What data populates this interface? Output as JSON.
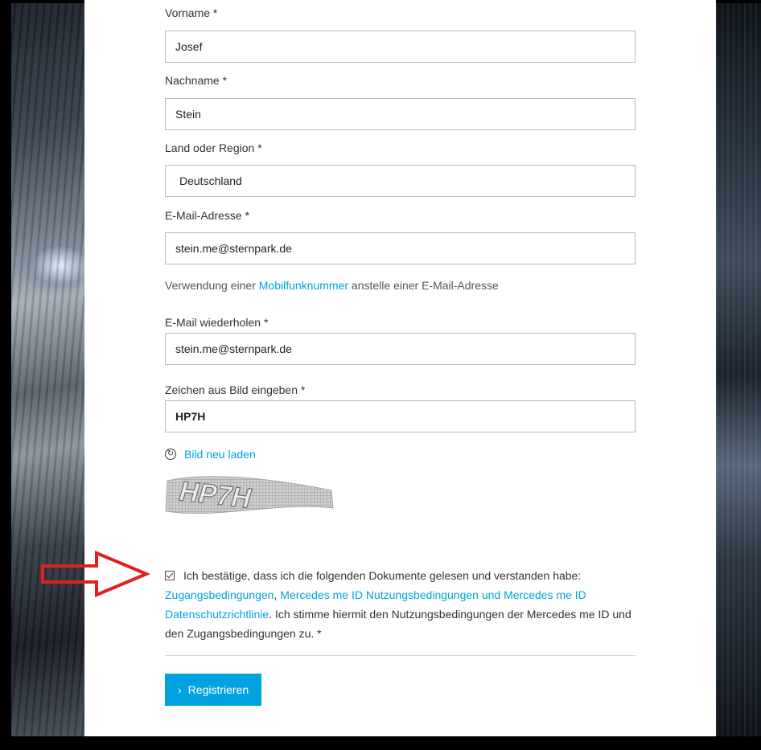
{
  "form": {
    "first_name": {
      "label": "Vorname *",
      "value": "Josef"
    },
    "last_name": {
      "label": "Nachname *",
      "value": "Stein"
    },
    "country": {
      "label": "Land oder Region *",
      "value": "Deutschland"
    },
    "email": {
      "label": "E-Mail-Adresse *",
      "value": "stein.me@sternpark.de"
    },
    "mobile_hint": {
      "prefix": "Verwendung einer ",
      "link": "Mobilfunknummer",
      "suffix": " anstelle einer E-Mail-Adresse"
    },
    "email_repeat": {
      "label": "E-Mail wiederholen *",
      "value": "stein.me@sternpark.de"
    },
    "captcha_input": {
      "label": "Zeichen aus Bild eingeben *",
      "value": "HP7H"
    },
    "captcha_reload": "Bild neu laden",
    "captcha_image_text": "HP7H",
    "consent": {
      "text_1": "Ich bestätige, dass ich die folgenden Dokumente gelesen und verstanden habe: ",
      "link_1": "Zugangsbedingungen",
      "sep": ", ",
      "link_2": "Mercedes me ID Nutzungsbedingungen und Mercedes me ID Datenschutzrichtlinie",
      "text_2": ". Ich stimme hiermit den Nutzungsbedingungen der Mercedes me ID und den Zugangsbedingungen zu. *",
      "checked": true
    },
    "register_button": "Registrieren",
    "register_chevron": "›"
  },
  "colors": {
    "accent": "#00a3e0",
    "annotation_arrow": "#e02020"
  },
  "icons": {
    "reload": "reload-icon",
    "checkbox": "checkbox-checked-icon",
    "button_chevron": "chevron-right-icon",
    "annotation": "red-arrow-icon"
  }
}
